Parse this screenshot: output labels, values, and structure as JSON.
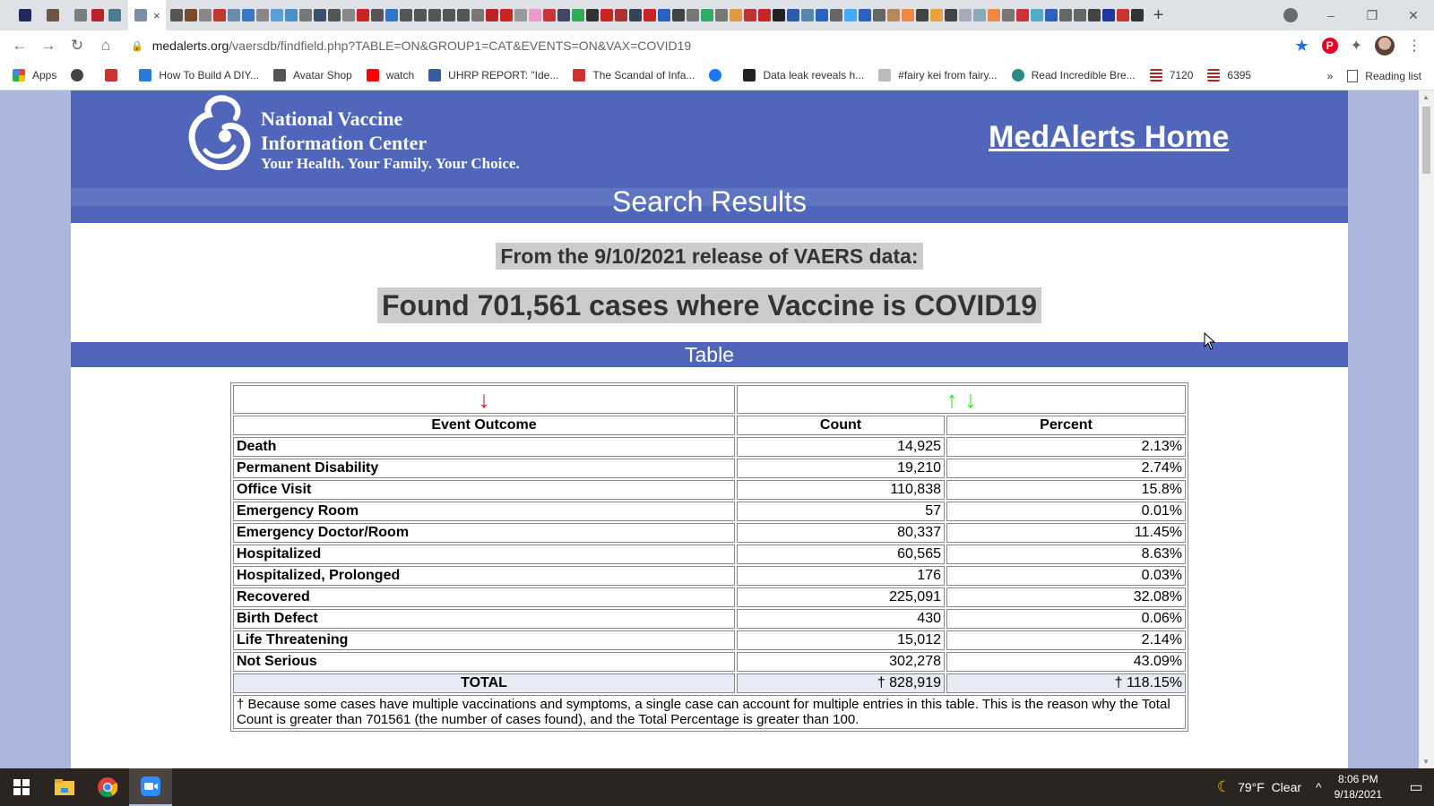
{
  "browser": {
    "active_tab_close": "×",
    "new_tab": "+",
    "window_controls": {
      "minimize": "–",
      "restore": "❐",
      "close": "✕"
    },
    "nav": {
      "back": "←",
      "forward": "→",
      "reload": "↻",
      "home": "⌂"
    },
    "url_host": "medalerts.org",
    "url_path": "/vaersdb/findfield.php?TABLE=ON&GROUP1=CAT&EVENTS=ON&VAX=COVID19",
    "bookmarks": [
      {
        "label": "Apps",
        "icon": "apps-grid-icon"
      },
      {
        "label": "",
        "icon": "globe-icon"
      },
      {
        "label": "",
        "icon": "horseshoe-icon"
      },
      {
        "label": "How To Build A DIY...",
        "icon": "drop-icon"
      },
      {
        "label": "Avatar Shop",
        "icon": "roblox-icon"
      },
      {
        "label": "watch",
        "icon": "youtube-icon"
      },
      {
        "label": "UHRP REPORT: \"Ide...",
        "icon": "doc-icon"
      },
      {
        "label": "The Scandal of Infa...",
        "icon": "site-icon"
      },
      {
        "label": "",
        "icon": "facebook-icon"
      },
      {
        "label": "Data leak reveals h...",
        "icon": "bbc-icon"
      },
      {
        "label": "#fairy kei from fairy...",
        "icon": "image-icon"
      },
      {
        "label": "Read Incredible Bre...",
        "icon": "book-icon"
      },
      {
        "label": "7120",
        "icon": "flag-icon"
      },
      {
        "label": "6395",
        "icon": "flag-icon"
      }
    ],
    "bookmarks_overflow": "»",
    "reading_list": "Reading list"
  },
  "site": {
    "org_line1": "National Vaccine",
    "org_line2": "Information Center",
    "tagline": "Your Health. Your Family. Your Choice.",
    "home_link": "MedAlerts Home",
    "section_title": "Search Results",
    "release_text": "From the 9/10/2021 release of VAERS data:",
    "found_text": "Found 701,561 cases where Vaccine is COVID19",
    "table_band": "Table",
    "colors": {
      "banner": "#4f66bb",
      "sidebar": "#adb6dc",
      "highlight": "#cccccc",
      "sort_red": "#e0102a",
      "sort_green": "#2ee62e"
    }
  },
  "table": {
    "sort_down": "↓",
    "sort_up": "↑",
    "headers": {
      "outcome": "Event Outcome",
      "count": "Count",
      "percent": "Percent"
    },
    "rows": [
      {
        "outcome": "Death",
        "count": "14,925",
        "percent": "2.13%"
      },
      {
        "outcome": "Permanent Disability",
        "count": "19,210",
        "percent": "2.74%"
      },
      {
        "outcome": "Office Visit",
        "count": "110,838",
        "percent": "15.8%"
      },
      {
        "outcome": "Emergency Room",
        "count": "57",
        "percent": "0.01%"
      },
      {
        "outcome": "Emergency Doctor/Room",
        "count": "80,337",
        "percent": "11.45%"
      },
      {
        "outcome": "Hospitalized",
        "count": "60,565",
        "percent": "8.63%"
      },
      {
        "outcome": "Hospitalized, Prolonged",
        "count": "176",
        "percent": "0.03%"
      },
      {
        "outcome": "Recovered",
        "count": "225,091",
        "percent": "32.08%"
      },
      {
        "outcome": "Birth Defect",
        "count": "430",
        "percent": "0.06%"
      },
      {
        "outcome": "Life Threatening",
        "count": "15,012",
        "percent": "2.14%"
      },
      {
        "outcome": "Not Serious",
        "count": "302,278",
        "percent": "43.09%"
      }
    ],
    "total": {
      "outcome": "TOTAL",
      "count": "† 828,919",
      "percent": "† 118.15%"
    },
    "footnote": "† Because some cases have multiple vaccinations and symptoms, a single case can account for multiple entries in this table. This is the reason why the Total Count is greater than 701561 (the number of cases found), and the Total Percentage is greater than 100."
  },
  "taskbar": {
    "weather": "79°F  Clear",
    "time": "8:06 PM",
    "date": "9/18/2021",
    "tray_chevron": "^"
  }
}
